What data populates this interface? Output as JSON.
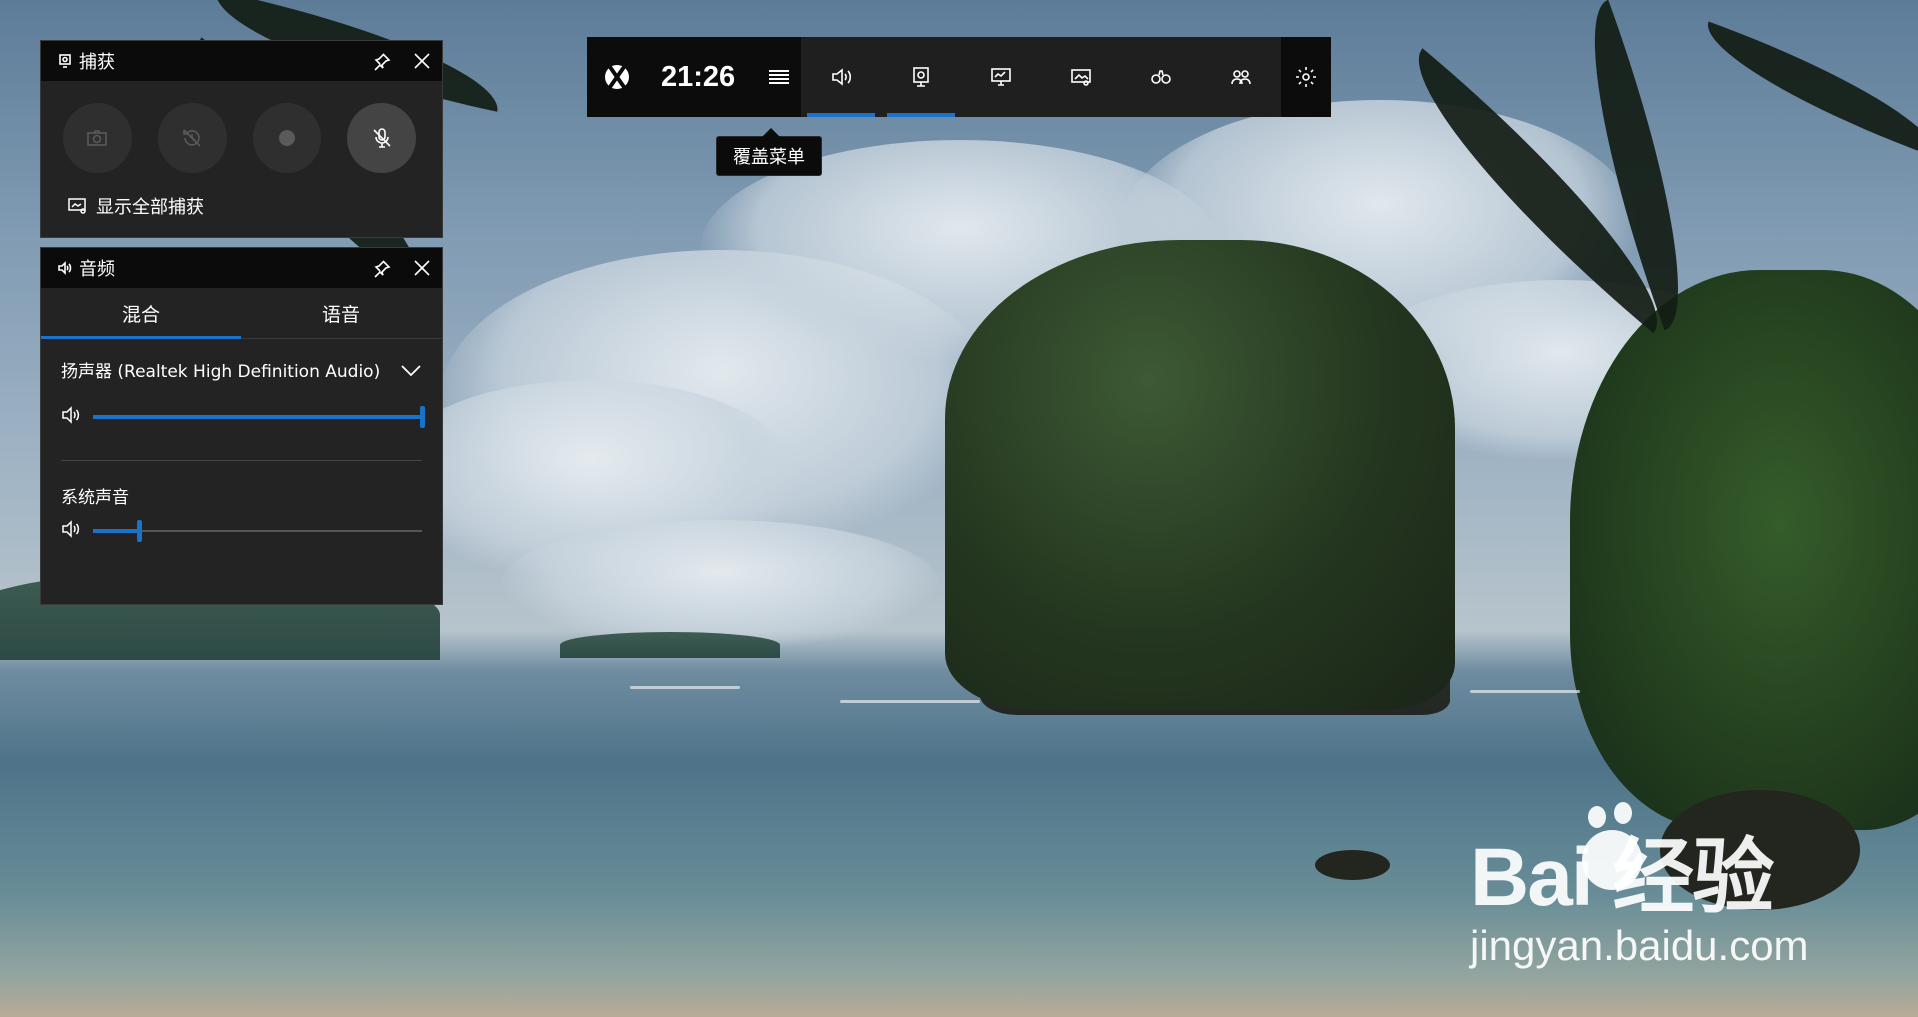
{
  "gamebar": {
    "time": "21:26",
    "menu_tooltip": "覆盖菜单",
    "buttons": [
      {
        "icon": "volume-icon",
        "active": true
      },
      {
        "icon": "capture-icon",
        "active": true
      },
      {
        "icon": "performance-icon",
        "active": false
      },
      {
        "icon": "gallery-icon",
        "active": false
      },
      {
        "icon": "looking-for-group-icon",
        "active": false
      },
      {
        "icon": "xbox-social-icon",
        "active": false
      }
    ],
    "settings_icon": "gear-icon"
  },
  "capture_widget": {
    "title": "捕获",
    "buttons": [
      "screenshot-icon",
      "record-last-icon",
      "record-icon",
      "mic-off-icon"
    ],
    "show_all": "显示全部捕获"
  },
  "audio_widget": {
    "title": "音频",
    "tabs": [
      "混合",
      "语音"
    ],
    "active_tab": "混合",
    "device": "扬声器 (Realtek High Definition Audio)",
    "device_volume": 1.0,
    "apps": [
      {
        "name": "系统声音",
        "volume": 0.14
      }
    ]
  },
  "watermark": {
    "brand": "Bai  经验",
    "url": "jingyan.baidu.com"
  },
  "colors": {
    "accent": "#1a73c9",
    "panel": "#232323",
    "titlebar": "#0b0b0b"
  }
}
